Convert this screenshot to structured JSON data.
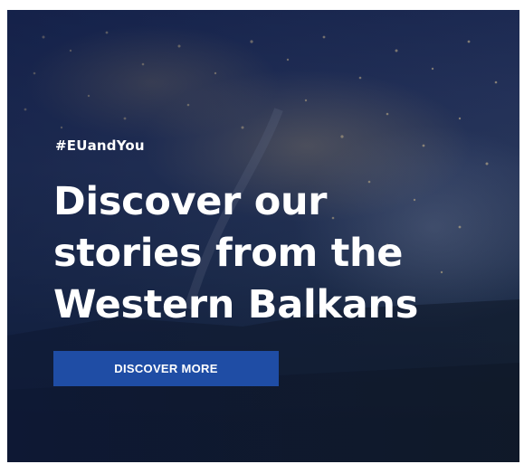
{
  "hero": {
    "hashtag": "#EUandYou",
    "headline_lines": [
      "Discover our",
      "stories from the",
      "Western Balkans"
    ],
    "cta_label": "DISCOVER MORE"
  },
  "colors": {
    "cta_background": "#1f4da5",
    "text": "#ffffff",
    "overlay": "#0c1840"
  }
}
